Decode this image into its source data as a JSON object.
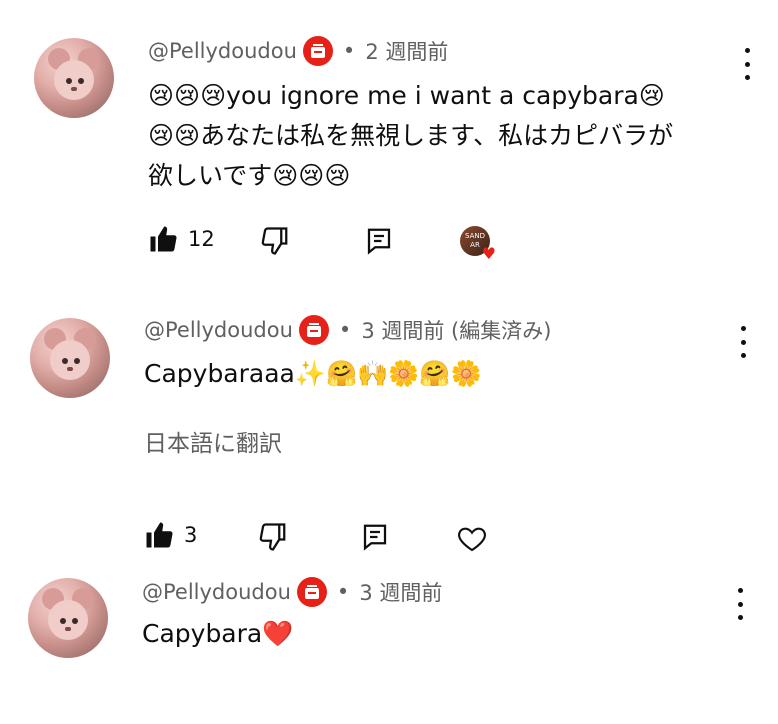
{
  "comments": [
    {
      "author": "@Pellydoudou",
      "time": "2 週間前",
      "lines": [
        "😢😢😢you ignore me i want a capybara😢",
        "😢😢あなたは私を無視します、私はカピバラが",
        "欲しいです😢😢😢"
      ],
      "likes": "12",
      "creator_heart_text": "SAND AR"
    },
    {
      "author": "@Pellydoudou",
      "time": "3 週間前 (編集済み)",
      "lines": [
        "Capybaraaa✨🤗🙌🌼🤗🌼"
      ],
      "translate": "日本語に翻訳",
      "likes": "3"
    },
    {
      "author": "@Pellydoudou",
      "time": "3 週間前",
      "lines": [
        "Capybara❤️"
      ]
    }
  ],
  "icons": {
    "like": "thumbs-up-icon",
    "dislike": "thumbs-down-icon",
    "reply": "reply-icon",
    "heart": "heart-outline-icon",
    "more": "more-vertical-icon",
    "badge": "member-badge-icon"
  },
  "colors": {
    "badge": "#e62117",
    "meta": "#606060",
    "text": "#0f0f0f"
  }
}
